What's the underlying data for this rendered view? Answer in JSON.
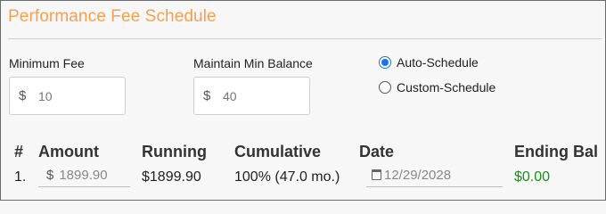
{
  "section": {
    "title": "Performance Fee Schedule"
  },
  "min_fee": {
    "label": "Minimum Fee",
    "currency": "$",
    "value": "10"
  },
  "maintain_min": {
    "label": "Maintain Min Balance",
    "currency": "$",
    "value": "40"
  },
  "schedule_mode": {
    "options": [
      {
        "label": "Auto-Schedule",
        "checked": true
      },
      {
        "label": "Custom-Schedule",
        "checked": false
      }
    ]
  },
  "table": {
    "headers": [
      "#",
      "Amount",
      "Running",
      "Cumulative",
      "Date",
      "Ending Bal"
    ],
    "rows": [
      {
        "num": "1.",
        "amount_currency": "$",
        "amount": "1899.90",
        "running": "$1899.90",
        "cumulative": "100% (47.0 mo.)",
        "date": "12/29/2028",
        "ending_bal": "$0.00"
      }
    ]
  },
  "colors": {
    "title": "#f5a04f",
    "radio_accent": "#1a73e8",
    "ending_bal": "#1a8f1a"
  },
  "icons": {
    "date": "calendar-icon"
  }
}
